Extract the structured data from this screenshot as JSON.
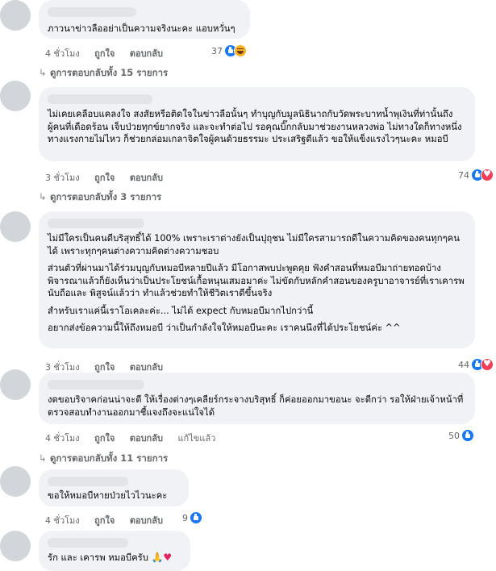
{
  "comments": [
    {
      "text": [
        "ภาวนาข่าวลืออย่าเป็นความจริงนะคะ แอบหวั่นๆ"
      ],
      "time": "4 ชั่วโมง",
      "like": "ถูกใจ",
      "reply": "ตอบกลับ",
      "reaction_count": "37",
      "reactions": [
        "like",
        "haha"
      ]
    },
    {
      "text": [
        "ไม่เคยเคลือบแคลงใจ สงสัยหรือติดใจในข่าวลือนั้นๆ ทำบุญกับมูลนิธินาถกับวัดพระบาทน้ำพุเงินที่ท่านั้นถึงผู้คนที่เดือดร้อน เจ็บป่วยทุกข์ยากจริง และจะทำต่อไป รอคุณบิ๊กกลับมาช่วยงานหลวงพ่อ ไม่ทางใดก็ทางหนึ่ง ทางแรงกายไม่ไหว ก็ช่วยกล่อมเกลาจิตใจผู้คนด้วยธรรมะ ประเสริฐดีแล้ว ขอให้แข็งแรงไวๆนะคะ หมอบี"
      ],
      "time": "3 ชั่วโมง",
      "like": "ถูกใจ",
      "reply": "ตอบกลับ",
      "reaction_count": "74",
      "reactions": [
        "like",
        "love"
      ]
    },
    {
      "text": [
        "ไม่มีใครเป็นคนดีบริสุทธิ์ได้ 100% เพราะเราต่างยังเป็นปุถุชน ไม่มีใครสามารถดีในความคิดของคนทุกๆคนได้ เพราะทุกๆคนต่างความคิดต่างความชอบ",
        "ส่วนตัวที่ผ่านมาได้ร่วมบุญกับหมอบีหลายปีแล้ว มีโอกาสพบปะพูดคุย ฟังคำสอนที่หมอบีมาถ่ายทอดบ้าง พิจารณาแล้วก็ยังเห็นว่าเป็นประโยชน์เกื้อหนุนเสมอมาค่ะ ไม่ขัดกับหลักคำสอนของครูบาอาจารย์ที่เราเคารพนับถือและ พิสูจน์แล้วว่า ทำแล้วช่วยทำให้ชีวิตเราดีขึ้นจริง",
        "สำหรับเราแค่นี้เราโอเคละค่ะ... ไม่ได้ expect กับหมอบีมากไปกว่านี้",
        "อยากส่งข้อความนี้ให้ถึงหมอบี ว่าเป็นกำลังใจให้หมอบีนะคะ เราคนนึงที่ได้ประโยชน์ค่ะ ^^"
      ],
      "time": "3 ชั่วโมง",
      "like": "ถูกใจ",
      "reply": "ตอบกลับ",
      "reaction_count": "44",
      "reactions": [
        "like",
        "love"
      ]
    },
    {
      "text": [
        "งดขอบริจาคก่อนน่าจะดี ให้เรื่องต่างๆเคลียร์กระจางบริสุทธิ์ ก็ค่อยออกมาขอนะ จะดีกว่า รอให้ฝ่ายเจ้าหน้าที่ตรวจสอบทำงานออกมาชี้แจงถึงจะแน่ใจได้"
      ],
      "time": "4 ชั่วโมง",
      "like": "ถูกใจ",
      "reply": "ตอบกลับ",
      "edited": "แก้ไขแล้ว",
      "reaction_count": "50",
      "reactions": [
        "like"
      ]
    },
    {
      "text": [
        "ขอให้หมอบีหายป่วยไวไวนะคะ"
      ],
      "time": "4 ชั่วโมง",
      "like": "ถูกใจ",
      "reply": "ตอบกลับ",
      "reaction_count": "9",
      "reactions": [
        "like"
      ]
    },
    {
      "text": [
        "รัก และ เคารพ หมอบีครับ"
      ],
      "emoji": [
        "🙏",
        "♥"
      ]
    }
  ],
  "reply_links": [
    "ดูการตอบกลับทั้ง 15 รายการ",
    "ดูการตอบกลับทั้ง 3 รายการ",
    "ดูการตอบกลับทั้ง 11 รายการ"
  ],
  "colors": {
    "like": "#1877f2",
    "love": "#f33e58",
    "haha": "#f7b125",
    "bubble": "#f0f2f5",
    "meta": "#65676b"
  }
}
